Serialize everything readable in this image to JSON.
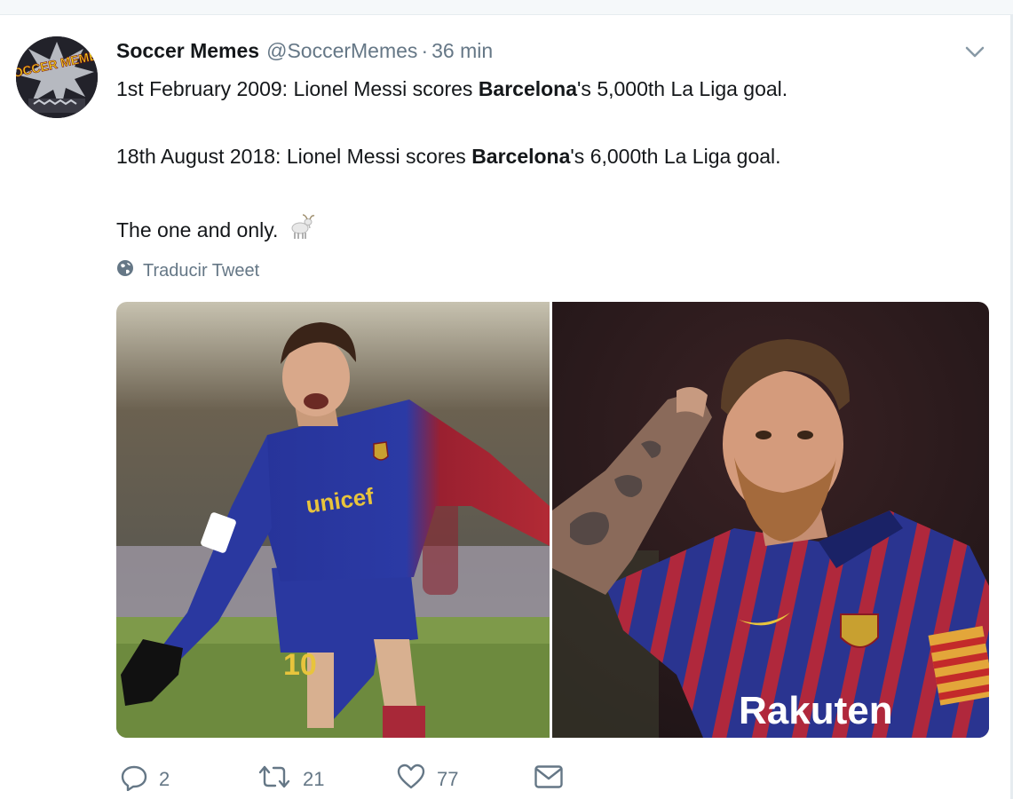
{
  "tweet": {
    "avatar_text": "SOCCER MEMES",
    "author_name": "Soccer Memes",
    "author_handle": "@SoccerMemes",
    "separator": "·",
    "timestamp": "36 min",
    "lines": [
      {
        "before": "1st February 2009: Lionel Messi scores ",
        "bold": "Barcelona",
        "after": "'s 5,000th La Liga goal."
      },
      {
        "before": "18th August 2018: Lionel Messi scores ",
        "bold": "Barcelona",
        "after": "'s 6,000th La Liga goal."
      },
      {
        "text": "The one and only.",
        "emoji": "goat-emoji"
      }
    ],
    "translate_label": "Traducir Tweet",
    "media": {
      "left_photo": {
        "shirt_text": "unicef",
        "number": "10"
      },
      "right_photo": {
        "shirt_text": "Rakuten"
      }
    },
    "actions": {
      "reply_count": "2",
      "retweet_count": "21",
      "like_count": "77"
    }
  },
  "icons": {
    "caret": "chevron-down-icon",
    "translate": "globe-icon",
    "reply": "reply-icon",
    "retweet": "retweet-icon",
    "like": "heart-icon",
    "dm": "envelope-icon"
  },
  "colors": {
    "text": "#14171a",
    "secondary": "#657786",
    "barca_blue": "#1f3c9a",
    "barca_red": "#a8203a"
  }
}
